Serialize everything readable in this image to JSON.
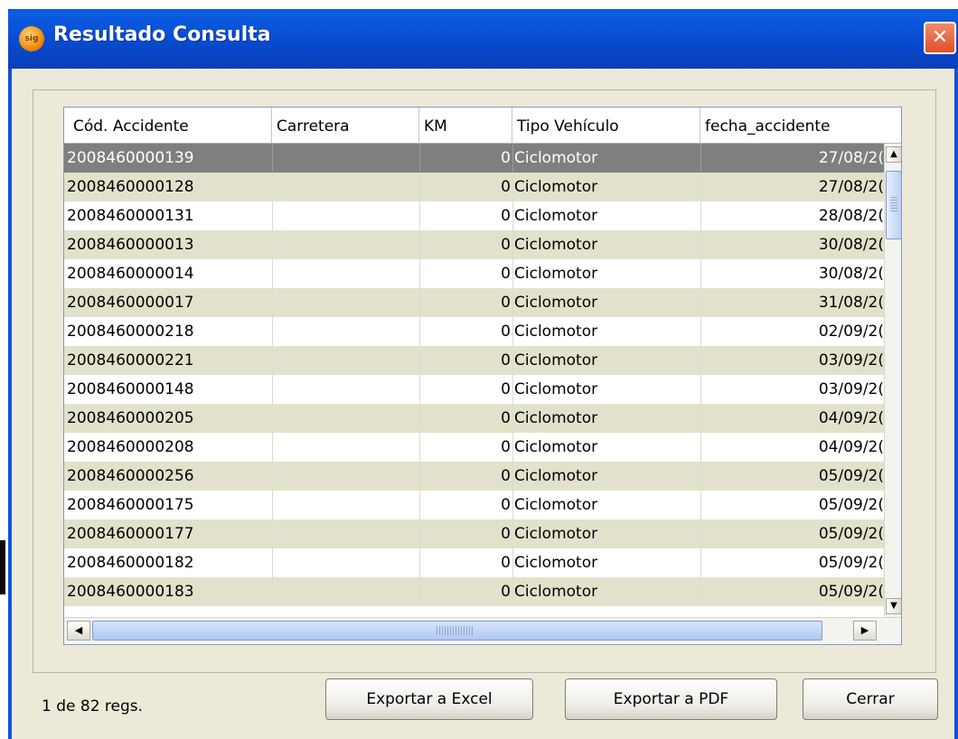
{
  "window": {
    "title": "Resultado Consulta",
    "icon": "app-orb-icon",
    "close_icon": "close-icon"
  },
  "table": {
    "columns": [
      "Cód. Accidente",
      "Carretera",
      "KM",
      "Tipo Vehículo",
      "fecha_accidente"
    ],
    "selected_row_index": 0,
    "rows": [
      [
        "2008460000139",
        "",
        "0",
        "Ciclomotor",
        "27/08/2("
      ],
      [
        "2008460000128",
        "",
        "0",
        "Ciclomotor",
        "27/08/2("
      ],
      [
        "2008460000131",
        "",
        "0",
        "Ciclomotor",
        "28/08/2("
      ],
      [
        "2008460000013",
        "",
        "0",
        "Ciclomotor",
        "30/08/2("
      ],
      [
        "2008460000014",
        "",
        "0",
        "Ciclomotor",
        "30/08/2("
      ],
      [
        "2008460000017",
        "",
        "0",
        "Ciclomotor",
        "31/08/2("
      ],
      [
        "2008460000218",
        "",
        "0",
        "Ciclomotor",
        "02/09/2("
      ],
      [
        "2008460000221",
        "",
        "0",
        "Ciclomotor",
        "03/09/2("
      ],
      [
        "2008460000148",
        "",
        "0",
        "Ciclomotor",
        "03/09/2("
      ],
      [
        "2008460000205",
        "",
        "0",
        "Ciclomotor",
        "04/09/2("
      ],
      [
        "2008460000208",
        "",
        "0",
        "Ciclomotor",
        "04/09/2("
      ],
      [
        "2008460000256",
        "",
        "0",
        "Ciclomotor",
        "05/09/2("
      ],
      [
        "2008460000175",
        "",
        "0",
        "Ciclomotor",
        "05/09/2("
      ],
      [
        "2008460000177",
        "",
        "0",
        "Ciclomotor",
        "05/09/2("
      ],
      [
        "2008460000182",
        "",
        "0",
        "Ciclomotor",
        "05/09/2("
      ],
      [
        "2008460000183",
        "",
        "0",
        "Ciclomotor",
        "05/09/2("
      ]
    ],
    "scroll_icons": {
      "up": "arrow-up-icon",
      "down": "arrow-down-icon",
      "left": "arrow-left-icon",
      "right": "arrow-right-icon"
    }
  },
  "footer": {
    "status": "1 de 82 regs.",
    "export_excel_label": "Exportar a Excel",
    "export_pdf_label": "Exportar a PDF",
    "close_label": "Cerrar"
  },
  "colors": {
    "titlebar": "#0a53d8",
    "row_even": "#e2e2cc",
    "row_selected": "#7f7f7f",
    "client_bg": "#ece9d8"
  }
}
